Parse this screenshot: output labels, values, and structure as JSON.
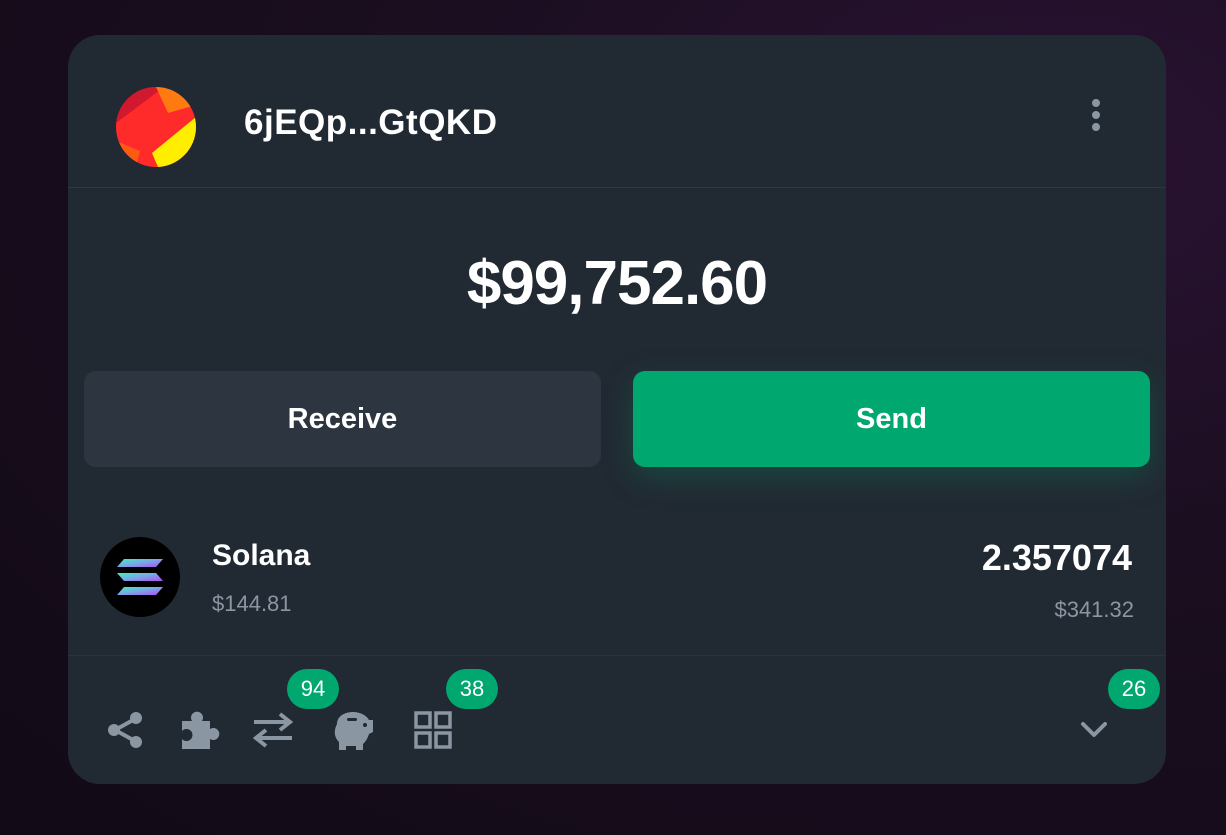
{
  "wallet": {
    "address": "6jEQp...GtQKD",
    "avatar_icon": "wallet-avatar-gradient",
    "menu_icon": "more-vertical-icon"
  },
  "balance": {
    "total": "$99,752.60"
  },
  "actions": {
    "receive_label": "Receive",
    "send_label": "Send"
  },
  "tokens": [
    {
      "name": "Solana",
      "price": "$144.81",
      "amount": "2.357074",
      "value": "$341.32",
      "icon": "solana-icon"
    }
  ],
  "footer": {
    "icons": [
      "share-icon",
      "puzzle-icon",
      "swap-icon",
      "piggy-bank-icon",
      "grid-icon",
      "chevron-down-icon"
    ],
    "badges": {
      "swap": "94",
      "grid": "38",
      "chevron": "26"
    }
  },
  "colors": {
    "accent": "#00a76e",
    "card_background": "#212932",
    "secondary_button": "#2d3640",
    "muted_text": "#8b96a3"
  }
}
